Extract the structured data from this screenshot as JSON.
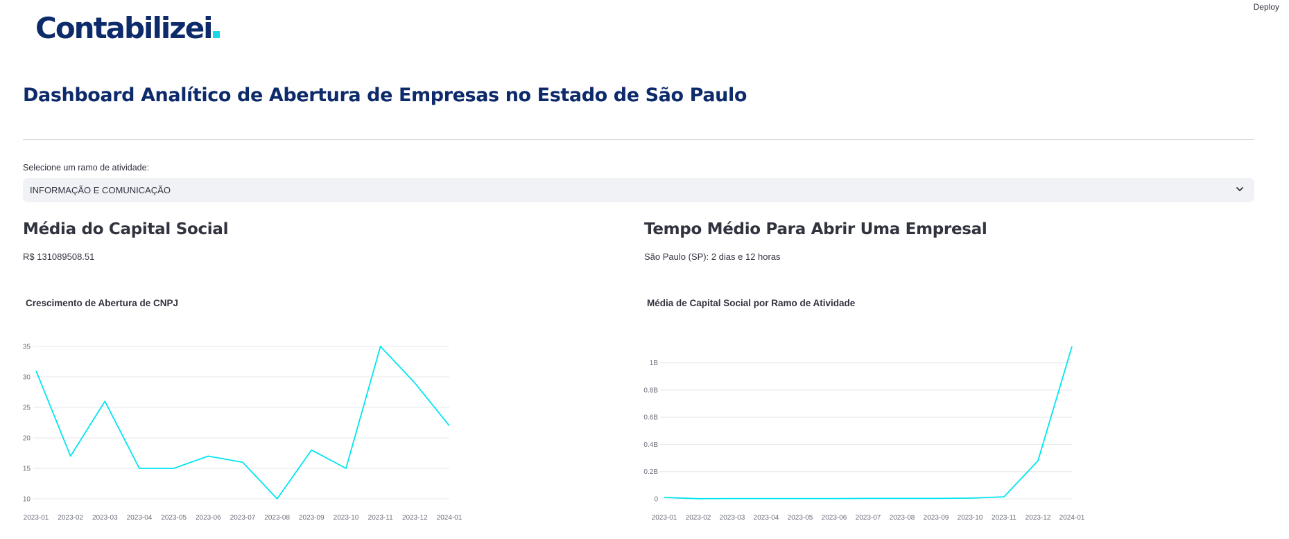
{
  "app": {
    "deploy_label": "Deploy",
    "logo_text": "Contabilizei",
    "accent_color": "#18d6e6",
    "brand_color": "#0d2a6a"
  },
  "page": {
    "title": "Dashboard Analítico de Abertura de Empresas no Estado de São Paulo"
  },
  "filter": {
    "label": "Selecione um ramo de atividade:",
    "selected": "INFORMAÇÃO E COMUNICAÇÃO",
    "icon": "chevron-down-icon"
  },
  "capital": {
    "heading": "Média do Capital Social",
    "value": "R$ 131089508.51"
  },
  "tempo": {
    "heading": "Tempo Médio Para Abrir Uma Empresal",
    "value": "São Paulo (SP): 2 dias e 12 horas"
  },
  "chart_data": [
    {
      "type": "line",
      "title": "Crescimento de Abertura de CNPJ",
      "x": [
        "2023-01",
        "2023-02",
        "2023-03",
        "2023-04",
        "2023-05",
        "2023-06",
        "2023-07",
        "2023-08",
        "2023-09",
        "2023-10",
        "2023-11",
        "2023-12",
        "2024-01"
      ],
      "y": [
        31,
        17,
        26,
        15,
        15,
        17,
        16,
        10,
        18,
        15,
        35,
        29,
        22
      ],
      "yticks": [
        10,
        15,
        20,
        25,
        30,
        35
      ],
      "ytick_labels": [
        "10",
        "15",
        "20",
        "25",
        "30",
        "35"
      ],
      "ylim": [
        10,
        35
      ],
      "grid": true,
      "color": "#00e5f0"
    },
    {
      "type": "line",
      "title": "Média de Capital Social por Ramo de Atividade",
      "x": [
        "2023-01",
        "2023-02",
        "2023-03",
        "2023-04",
        "2023-05",
        "2023-06",
        "2023-07",
        "2023-08",
        "2023-09",
        "2023-10",
        "2023-11",
        "2023-12",
        "2024-01"
      ],
      "y": [
        10000000,
        1000000,
        2000000,
        2000000,
        2000000,
        2000000,
        3000000,
        3000000,
        3000000,
        5000000,
        15000000,
        280000000,
        1120000000
      ],
      "yticks": [
        0,
        200000000,
        400000000,
        600000000,
        800000000,
        1000000000
      ],
      "ytick_labels": [
        "0",
        "0.2B",
        "0.4B",
        "0.6B",
        "0.8B",
        "1B"
      ],
      "ylim": [
        0,
        1120000000
      ],
      "grid": true,
      "color": "#00e5f0"
    }
  ]
}
